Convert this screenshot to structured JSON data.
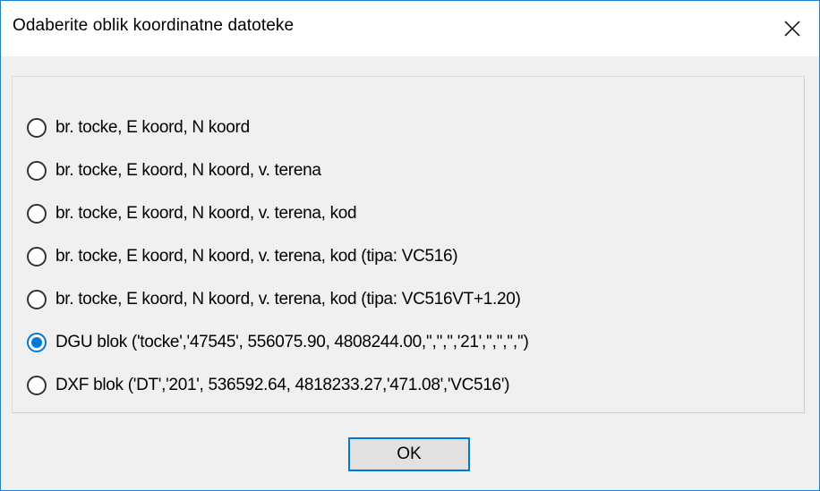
{
  "window": {
    "title": "Odaberite oblik koordinatne datoteke",
    "close_icon": "close-icon",
    "accent_color": "#0078d7"
  },
  "options": [
    {
      "label": "br. tocke, E koord, N koord",
      "selected": false
    },
    {
      "label": "br. tocke, E koord, N koord, v. terena",
      "selected": false
    },
    {
      "label": "br. tocke, E koord, N koord, v. terena, kod",
      "selected": false
    },
    {
      "label": "br. tocke, E koord, N koord, v. terena, kod (tipa: VC516)",
      "selected": false
    },
    {
      "label": "br. tocke, E koord, N koord, v. terena, kod (tipa: VC516VT+1.20)",
      "selected": false
    },
    {
      "label": "DGU blok ('tocke','47545', 556075.90, 4808244.00,'','','','21','','','','')",
      "selected": true
    },
    {
      "label": "DXF blok ('DT','201', 536592.64, 4818233.27,'471.08','VC516')",
      "selected": false
    }
  ],
  "buttons": {
    "ok_label": "OK"
  }
}
